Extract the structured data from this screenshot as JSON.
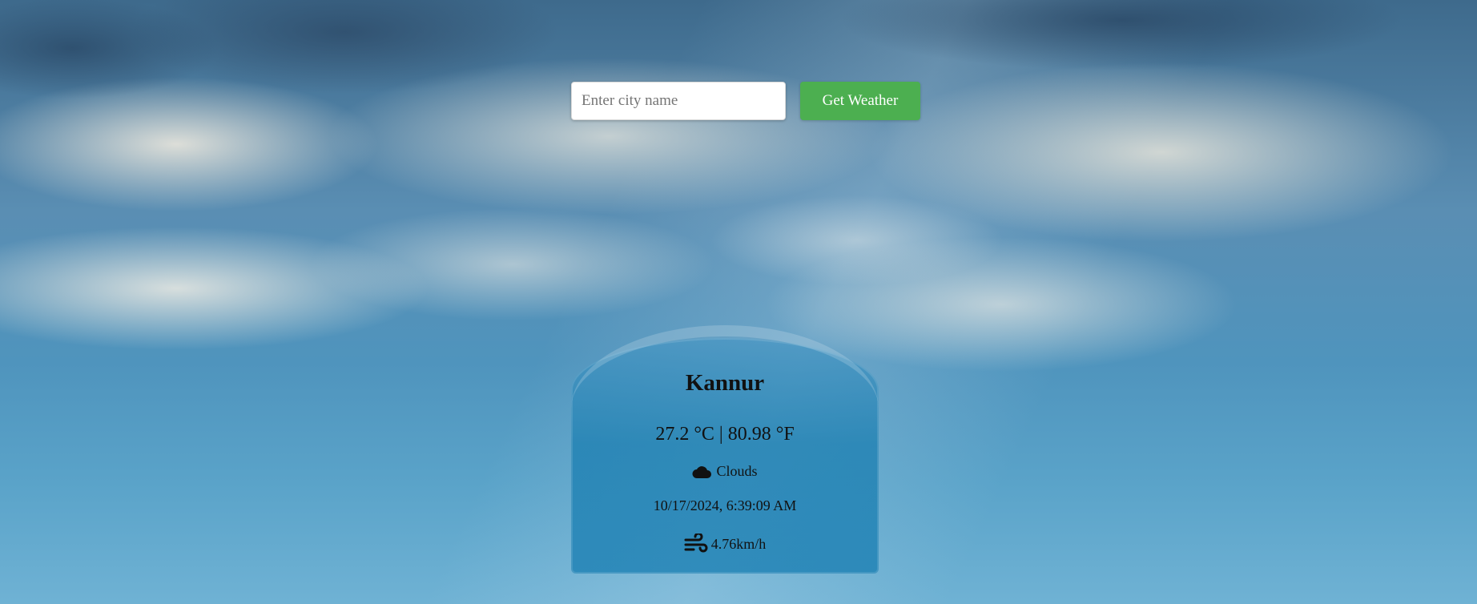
{
  "search": {
    "placeholder": "Enter city name",
    "value": "",
    "button_label": "Get Weather"
  },
  "weather": {
    "city": "Kannur",
    "temp_c": "27.2 °C",
    "temp_separator": "|",
    "temp_f": "80.98 °F",
    "condition": "Clouds",
    "condition_icon": "cloud-icon",
    "datetime": "10/17/2024, 6:39:09 AM",
    "wind_icon": "wind-icon",
    "wind_speed": "4.76km/h"
  },
  "colors": {
    "button_bg": "#4caf50",
    "card_bg": "#2a86b8"
  }
}
